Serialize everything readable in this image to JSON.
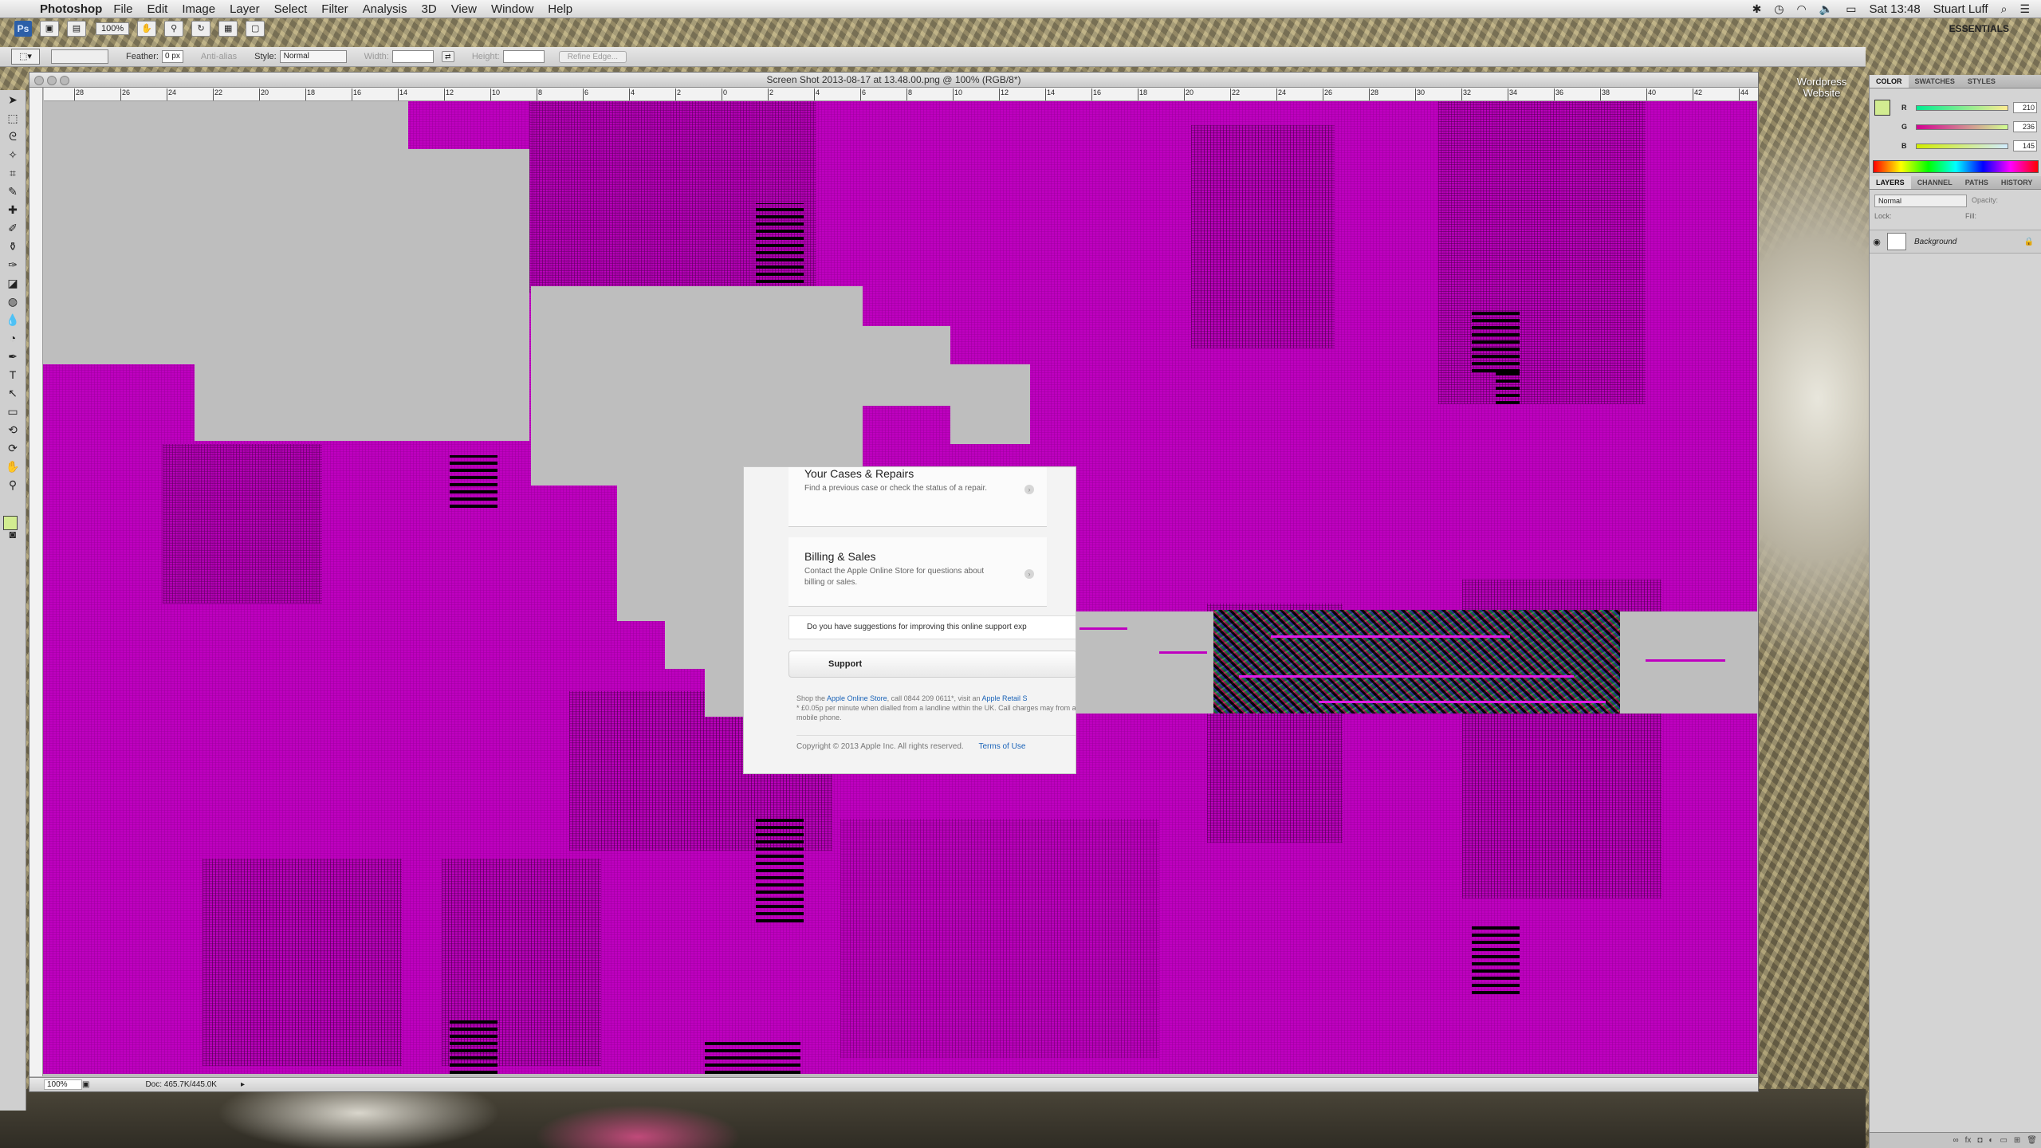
{
  "menubar": {
    "app_name": "Photoshop",
    "menus": [
      "File",
      "Edit",
      "Image",
      "Layer",
      "Select",
      "Filter",
      "Analysis",
      "3D",
      "View",
      "Window",
      "Help"
    ],
    "clock": "Sat 13:48",
    "user": "Stuart Luff"
  },
  "appbar": {
    "ps_badge": "Ps",
    "zoom": "100%",
    "workspace": "ESSENTIALS"
  },
  "tool_options": {
    "feather_label": "Feather:",
    "feather_value": "0 px",
    "antialias_label": "Anti-alias",
    "style_label": "Style:",
    "style_value": "Normal",
    "width_label": "Width:",
    "height_label": "Height:",
    "refine_edge": "Refine Edge..."
  },
  "document": {
    "title": "Screen Shot 2013-08-17 at 13.48.00.png @ 100% (RGB/8*)",
    "ruler_ticks": [
      "28",
      "26",
      "24",
      "22",
      "20",
      "18",
      "16",
      "14",
      "12",
      "10",
      "8",
      "6",
      "4",
      "2",
      "0",
      "2",
      "4",
      "6",
      "8",
      "10",
      "12",
      "14",
      "16",
      "18",
      "20",
      "22",
      "24",
      "26",
      "28",
      "30",
      "32",
      "34",
      "36",
      "38",
      "40",
      "42",
      "44"
    ],
    "status_zoom": "100%",
    "status_doc": "Doc: 465.7K/445.0K"
  },
  "web_fragment": {
    "card1_title": "Your Cases & Repairs",
    "card1_desc": "Find a previous case or check the status of a repair.",
    "card2_title": "Billing & Sales",
    "card2_desc": "Contact the Apple Online Store for questions about billing or sales.",
    "suggestion": "Do you have suggestions for improving this online support exp",
    "breadcrumb": "Support",
    "footer_prefix": "Shop the ",
    "footer_link1": "Apple Online Store",
    "footer_mid": ", call 0844 209 0611*, visit an ",
    "footer_link2": "Apple Retail S",
    "footer_note": "* £0.05p per minute when dialled from a landline within the UK. Call charges may from a mobile phone.",
    "copyright": "Copyright © 2013 Apple Inc. All rights reserved.",
    "terms": "Terms of Use"
  },
  "panels": {
    "color_tabs": [
      "COLOR",
      "SWATCHES",
      "STYLES"
    ],
    "r_label": "R",
    "g_label": "G",
    "b_label": "B",
    "r_value": "210",
    "g_value": "236",
    "b_value": "145",
    "layer_tabs": [
      "LAYERS",
      "CHANNEL",
      "PATHS",
      "HISTORY"
    ],
    "blend_mode": "Normal",
    "opacity_label": "Opacity:",
    "lock_label": "Lock:",
    "fill_label": "Fill:",
    "layer_name": "Background"
  },
  "desktop": {
    "icon_label": "Wordpress Website"
  },
  "colors": {
    "canvas_magenta": "#bf00c0",
    "foreground_swatch": "#d2ec91"
  }
}
